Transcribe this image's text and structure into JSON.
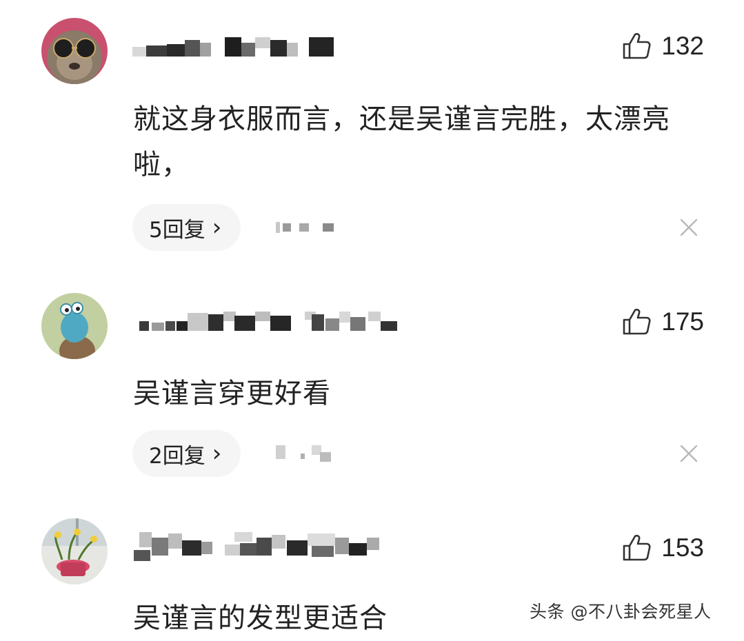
{
  "comments": [
    {
      "likes": "132",
      "text": "就这身衣服而言，还是吴谨言完胜，太漂亮啦，",
      "reply_label": "5回复",
      "reply_chevron": "›",
      "avatar_icon": "sunglasses-dog-avatar",
      "close_icon": "close-icon"
    },
    {
      "likes": "175",
      "text": "吴谨言穿更好看",
      "reply_label": "2回复",
      "reply_chevron": "›",
      "avatar_icon": "cartoon-frog-avatar",
      "close_icon": "close-icon"
    },
    {
      "likes": "153",
      "text": "吴谨言的发型更适合",
      "avatar_icon": "potted-plant-avatar"
    }
  ],
  "watermark": "头条 @不八卦会死星人",
  "colors": {
    "text": "#222222",
    "pill_bg": "#f5f5f5",
    "icon": "#333333",
    "close": "#b8b8b8"
  }
}
